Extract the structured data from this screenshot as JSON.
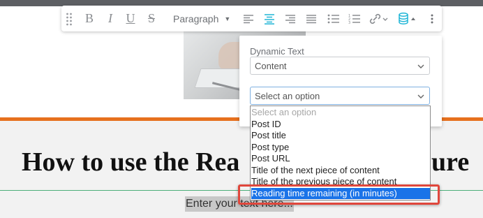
{
  "toolbar": {
    "bold_label": "B",
    "italic_label": "I",
    "underline_label": "U",
    "strike_label": "S",
    "paragraph_label": "Paragraph",
    "icons": [
      "drag-handle-icon",
      "align-left-icon",
      "align-center-icon",
      "align-right-icon",
      "justify-icon",
      "bulleted-list-icon",
      "numbered-list-icon",
      "link-icon",
      "database-icon",
      "more-icon"
    ],
    "accent_color": "#1fb5d6"
  },
  "dynamic_panel": {
    "title": "Dynamic Text",
    "source_value": "Content",
    "option_select_value": "Select an option"
  },
  "option_list": {
    "items": [
      "Select an option",
      "Post ID",
      "Post title",
      "Post type",
      "Post URL",
      "Title of the next piece of content",
      "Title of the previous piece of content",
      "Reading time remaining (in minutes)"
    ],
    "selected_index": 7
  },
  "page": {
    "headline": "How to use the Rea",
    "headline_tail": "ure",
    "placeholder": "Enter your text here..."
  },
  "colors": {
    "orange_rule": "#e6701e",
    "green_rule": "#4caf7a",
    "highlight": "#e0473c",
    "selection": "#1a73e8"
  }
}
